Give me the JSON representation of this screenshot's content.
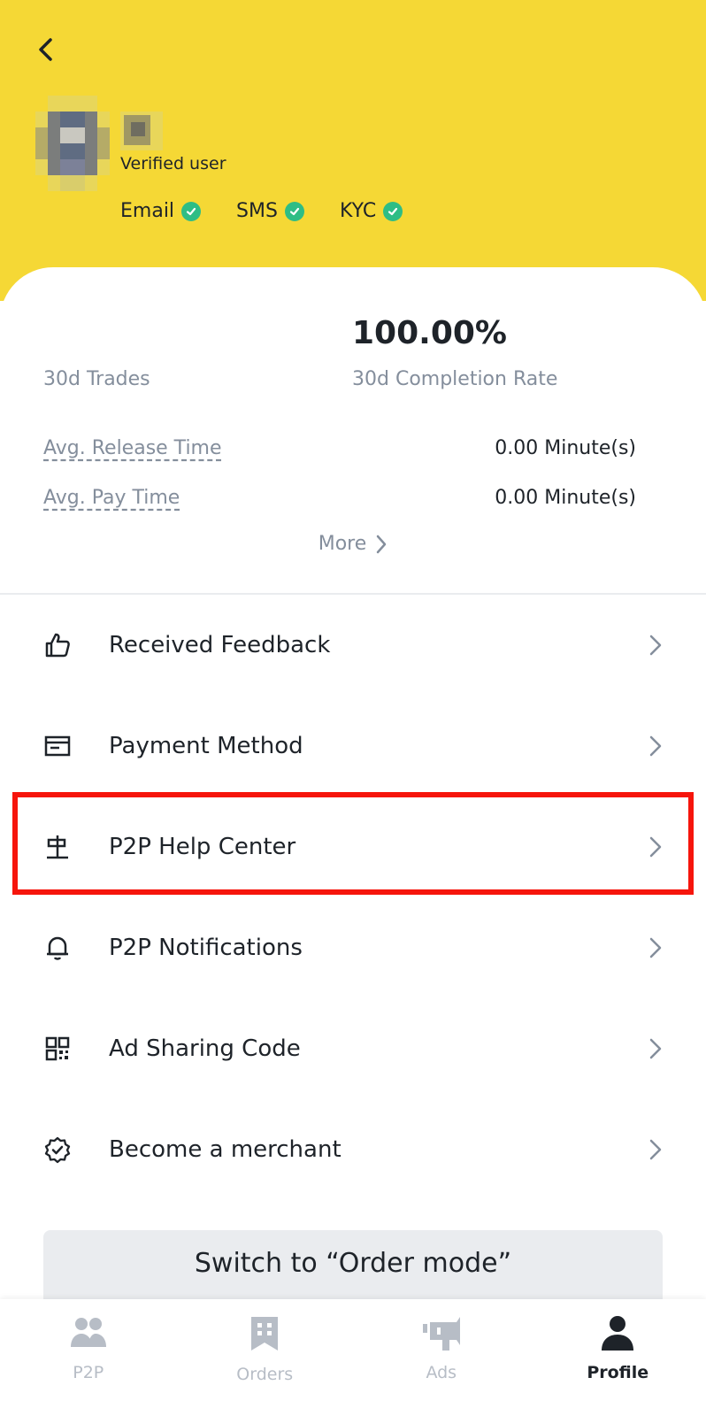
{
  "header": {
    "verified_text": "Verified user",
    "badges": [
      {
        "label": "Email"
      },
      {
        "label": "SMS"
      },
      {
        "label": "KYC"
      }
    ]
  },
  "stats": {
    "completion_rate_value": "100.00%",
    "trades_label": "30d Trades",
    "completion_rate_label": "30d Completion Rate",
    "release_label": "Avg. Release Time",
    "release_value": "0.00 Minute(s)",
    "pay_label": "Avg. Pay Time",
    "pay_value": "0.00 Minute(s)",
    "more_label": "More"
  },
  "menu": {
    "items": [
      {
        "label": "Received Feedback",
        "icon": "thumbs-up-icon"
      },
      {
        "label": "Payment Method",
        "icon": "card-icon"
      },
      {
        "label": "P2P Help Center",
        "icon": "signpost-icon"
      },
      {
        "label": "P2P Notifications",
        "icon": "bell-icon"
      },
      {
        "label": "Ad Sharing Code",
        "icon": "qr-code-icon"
      },
      {
        "label": "Become a merchant",
        "icon": "merchant-badge-icon"
      }
    ]
  },
  "switch_button": {
    "label": "Switch to “Order mode”"
  },
  "tabbar": {
    "tabs": [
      {
        "label": "P2P",
        "icon": "users-icon"
      },
      {
        "label": "Orders",
        "icon": "receipt-icon"
      },
      {
        "label": "Ads",
        "icon": "megaphone-icon"
      },
      {
        "label": "Profile",
        "icon": "person-icon"
      }
    ],
    "active": "Profile"
  },
  "colors": {
    "header_bg": "#f5d835",
    "check_green": "#2ebd85",
    "highlight_red": "#f6150c"
  }
}
